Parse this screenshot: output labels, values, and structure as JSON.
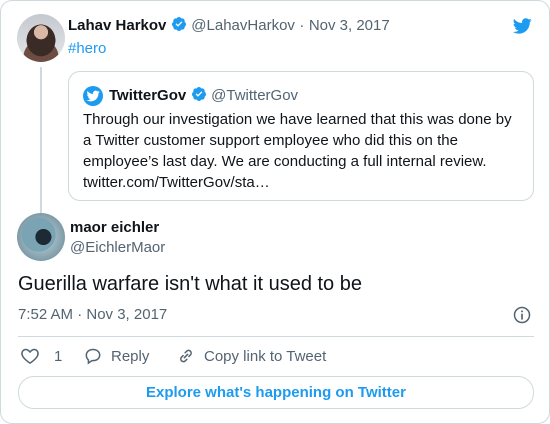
{
  "parent_tweet": {
    "name": "Lahav Harkov",
    "handle": "@LahavHarkov",
    "separator": "·",
    "date": "Nov 3, 2017",
    "text": "#hero",
    "quoted": {
      "name": "TwitterGov",
      "handle": "@TwitterGov",
      "text_lines": [
        "Through our investigation we have learned that this was done by",
        "a Twitter customer support employee who did this on the",
        "employee’s last day. We are conducting a full internal review.",
        "twitter.com/TwitterGov/sta…"
      ]
    }
  },
  "main_tweet": {
    "name": "maor eichler",
    "handle": "@EichlerMaor",
    "text": "Guerilla warfare isn't what it used to be",
    "timestamp": "7:52 AM · Nov 3, 2017"
  },
  "actions": {
    "like_count": "1",
    "reply_label": "Reply",
    "copy_label": "Copy link to Tweet"
  },
  "footer": {
    "explore_label": "Explore what's happening on Twitter"
  },
  "colors": {
    "accent": "#1d9bf0",
    "text": "#0f1419",
    "secondary": "#536471",
    "border": "#cfd9de"
  },
  "icons": [
    "twitter-bird-icon",
    "verified-icon",
    "info-icon",
    "heart-icon",
    "reply-icon",
    "link-icon"
  ]
}
